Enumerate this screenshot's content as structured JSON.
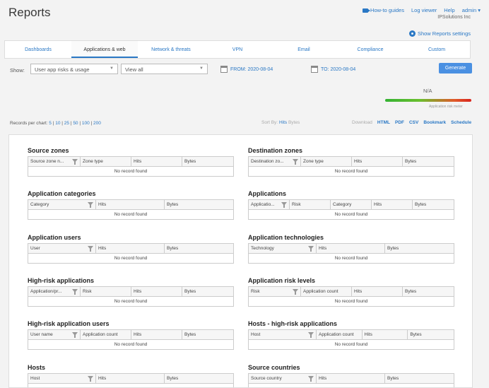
{
  "page": {
    "title": "Reports"
  },
  "header": {
    "links": [
      "How-to guides",
      "Log viewer",
      "Help",
      "admin"
    ],
    "org": "IPSolutions Inc",
    "show_settings": "Show Reports settings"
  },
  "tabs": [
    "Dashboards",
    "Applications & web",
    "Network & threats",
    "VPN",
    "Email",
    "Compliance",
    "Custom"
  ],
  "filters": {
    "show_label": "Show:",
    "report_select": "User app risks & usage",
    "view_select": "View all",
    "from_label": "FROM: 2020-08-04",
    "to_label": "TO: 2020-08-04",
    "generate": "Generate"
  },
  "risk_meter": {
    "value": "N/A",
    "label": "Application risk meter"
  },
  "records": {
    "label": "Records per chart:",
    "options": [
      "5",
      "10",
      "25",
      "50",
      "100",
      "200"
    ]
  },
  "sort": {
    "label": "Sort By:",
    "hits": "Hits",
    "bytes": "Bytes"
  },
  "download": {
    "label": "Download",
    "items": [
      "HTML",
      "PDF",
      "CSV",
      "Bookmark",
      "Schedule"
    ]
  },
  "reports": [
    {
      "title": "Source zones",
      "cols": [
        "Source zone n...",
        "Zone type",
        "Hits",
        "Bytes"
      ],
      "empty": "No record found"
    },
    {
      "title": "Destination zones",
      "cols": [
        "Destination zo...",
        "Zone type",
        "Hits",
        "Bytes"
      ],
      "empty": "No record found"
    },
    {
      "title": "Application categories",
      "cols": [
        "Category",
        "Hits",
        "Bytes"
      ],
      "empty": "No record found"
    },
    {
      "title": "Applications",
      "cols": [
        "Applicatio...",
        "Risk",
        "Category",
        "Hits",
        "Bytes"
      ],
      "empty": "No record found"
    },
    {
      "title": "Application users",
      "cols": [
        "User",
        "Hits",
        "Bytes"
      ],
      "empty": "No record found"
    },
    {
      "title": "Application technologies",
      "cols": [
        "Technology",
        "Hits",
        "Bytes"
      ],
      "empty": "No record found"
    },
    {
      "title": "High-risk applications",
      "cols": [
        "Application/pr...",
        "Risk",
        "Hits",
        "Bytes"
      ],
      "empty": "No record found"
    },
    {
      "title": "Application risk levels",
      "cols": [
        "Risk",
        "Application count",
        "Hits",
        "Bytes"
      ],
      "empty": "No record found"
    },
    {
      "title": "High-risk application users",
      "cols": [
        "User name",
        "Application count",
        "Hits",
        "Bytes"
      ],
      "empty": "No record found"
    },
    {
      "title": "Hosts - high-risk applications",
      "cols": [
        "Host",
        "Application count",
        "Hits",
        "Bytes"
      ],
      "empty": "No record found"
    },
    {
      "title": "Hosts",
      "cols": [
        "Host",
        "Hits",
        "Bytes"
      ],
      "empty": ""
    },
    {
      "title": "Source countries",
      "cols": [
        "Source country",
        "Hits",
        "Bytes"
      ],
      "empty": ""
    }
  ]
}
